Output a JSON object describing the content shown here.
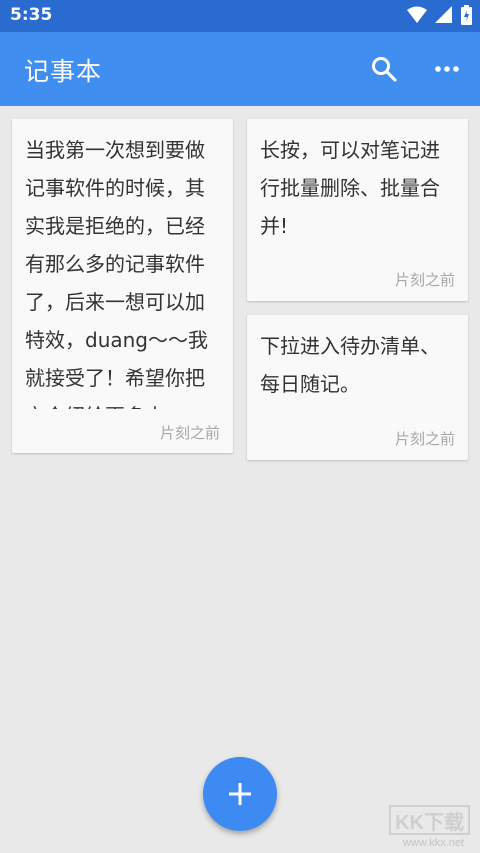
{
  "status_bar": {
    "time": "5:35"
  },
  "app_bar": {
    "title": "记事本",
    "search_icon": "search-icon",
    "more_icon": "more-horizontal-icon"
  },
  "notes": [
    {
      "text": "当我第一次想到要做记事软件的时候，其实我是拒绝的，已经有那么多的记事软件了，后来一想可以加特效，duang～～我就接受了！希望你把它介绍给更多人",
      "time": "片刻之前"
    },
    {
      "text": "长按，可以对笔记进行批量删除、批量合并!",
      "time": "片刻之前"
    },
    {
      "text": "下拉进入待办清单、每日随记。",
      "time": "片刻之前"
    }
  ],
  "fab": {
    "icon": "plus-icon"
  },
  "watermark": {
    "brand": "KK下载",
    "url": "www.kkx.net"
  },
  "colors": {
    "status_bar": "#2a6bd0",
    "app_bar": "#3f8ef0",
    "fab": "#3d8bf2",
    "background": "#e9e9e9"
  }
}
